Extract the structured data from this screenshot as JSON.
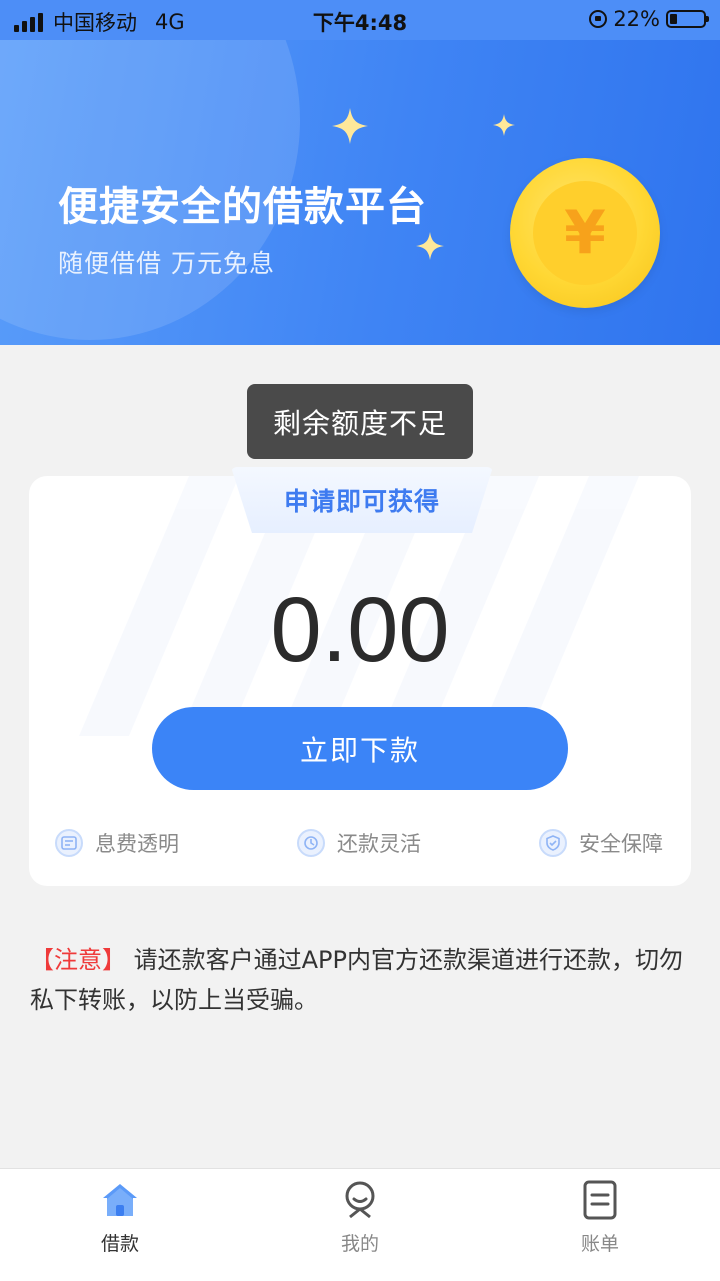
{
  "status_bar": {
    "carrier": "中国移动",
    "network": "4G",
    "time": "下午4:48",
    "battery_percent": "22%",
    "battery_level": 0.22
  },
  "banner": {
    "title": "便捷安全的借款平台",
    "subtitle": "随便借借 万元免息",
    "coin_symbol": "¥"
  },
  "toast": {
    "message": "剩余额度不足"
  },
  "card": {
    "label": "申请即可获得",
    "amount": "0.00",
    "button_label": "立即下款",
    "features": [
      {
        "icon": "fee-icon",
        "label": "息费透明"
      },
      {
        "icon": "repay-icon",
        "label": "还款灵活"
      },
      {
        "icon": "shield-icon",
        "label": "安全保障"
      }
    ]
  },
  "notice": {
    "tag": "【注意】",
    "text": "请还款客户通过APP内官方还款渠道进行还款，切勿私下转账，以防上当受骗。"
  },
  "bottom_nav": {
    "items": [
      {
        "icon": "home-icon",
        "label": "借款",
        "active": true
      },
      {
        "icon": "profile-icon",
        "label": "我的",
        "active": false
      },
      {
        "icon": "bill-icon",
        "label": "账单",
        "active": false
      }
    ]
  },
  "colors": {
    "primary": "#3b84f7",
    "notice_tag": "#ef3a3a",
    "coin": "#ffd733"
  }
}
